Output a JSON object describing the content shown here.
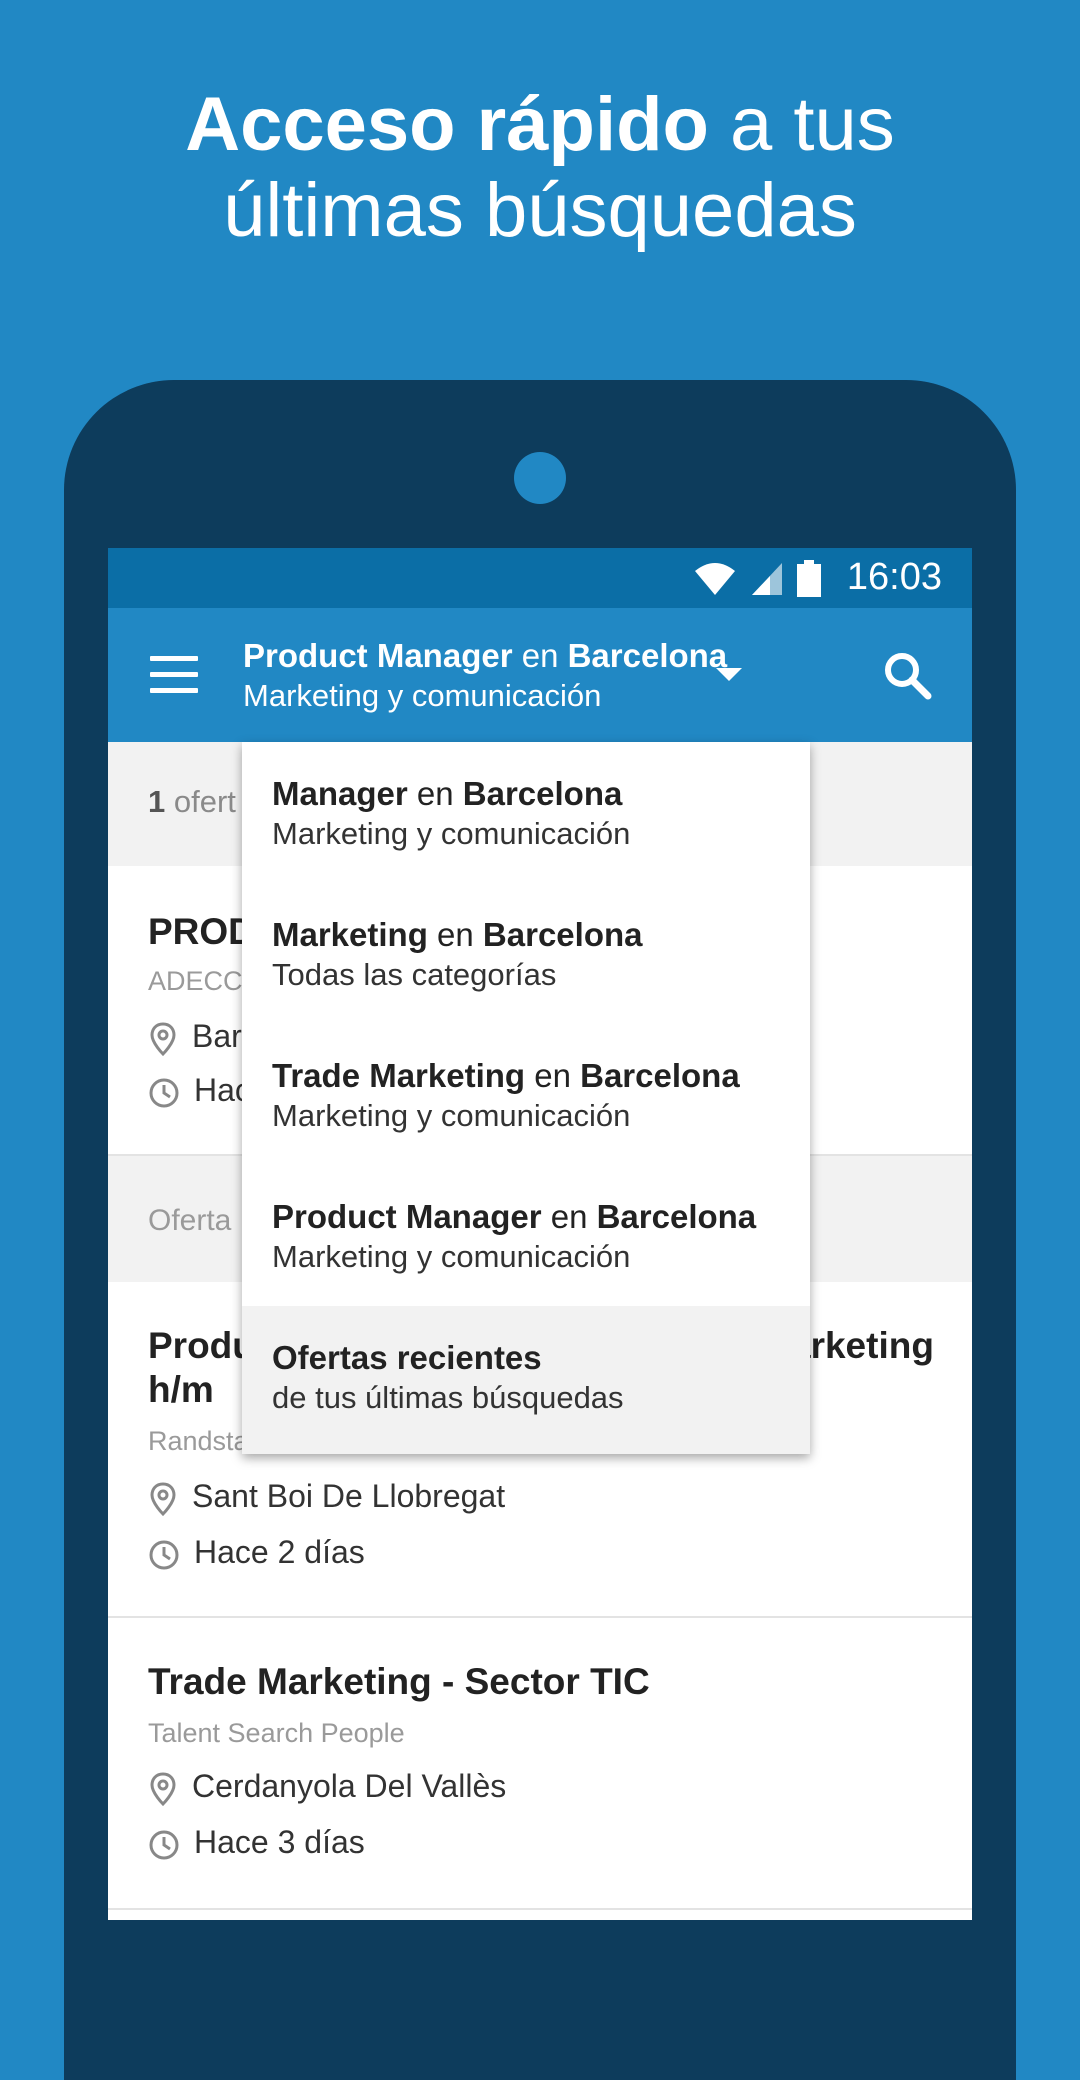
{
  "headline": {
    "bold": "Acceso rápido",
    "rest": " a tus",
    "line2": "últimas búsquedas"
  },
  "status_bar": {
    "time": "16:03"
  },
  "app_bar": {
    "query": "Product Manager",
    "connector": " en ",
    "location": "Barcelona",
    "category": "Marketing y comunicación"
  },
  "results": {
    "count": "1",
    "count_text": " ofert",
    "jobs": [
      {
        "title": "PROD",
        "company": "ADECCO",
        "location": "Bar",
        "time": "Hac"
      },
      {
        "title_left": "Produ",
        "title_right": "arketing",
        "title_line2": "h/m",
        "company": "Randsta",
        "location": "Sant Boi De Llobregat",
        "time": "Hace 2 días"
      },
      {
        "title": "Trade Marketing - Sector TIC",
        "company": "Talent Search People",
        "location": "Cerdanyola Del Vallès",
        "time": "Hace 3 días"
      }
    ],
    "section_label": "Oferta"
  },
  "dropdown": {
    "items": [
      {
        "query": "Manager",
        "connector": " en ",
        "location": "Barcelona",
        "category": "Marketing y comunicación"
      },
      {
        "query": "Marketing",
        "connector": " en ",
        "location": "Barcelona",
        "category": "Todas las categorías"
      },
      {
        "query": "Trade Marketing",
        "connector": " en ",
        "location": "Barcelona",
        "category": "Marketing y comunicación"
      },
      {
        "query": "Product Manager",
        "connector": " en ",
        "location": "Barcelona",
        "category": "Marketing y comunicación"
      }
    ],
    "recent": {
      "title": "Ofertas recientes",
      "subtitle": "de tus últimas búsquedas"
    }
  },
  "icons": {
    "menu": "hamburger-menu-icon",
    "search": "search-icon",
    "dropdown": "caret-down-icon",
    "location": "location-pin-icon",
    "time": "clock-icon",
    "wifi": "wifi-icon",
    "signal": "cell-signal-icon",
    "battery": "battery-icon"
  },
  "colors": {
    "background": "#2188c4",
    "phone_body": "#0d3c5c",
    "status_bar": "#0b6ea6",
    "app_bar": "#2188c4"
  }
}
